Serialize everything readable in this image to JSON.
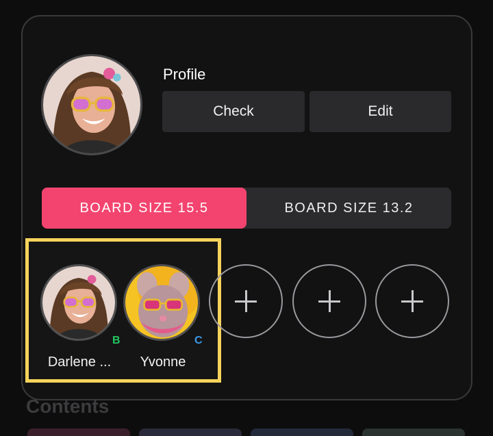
{
  "profile": {
    "label": "Profile",
    "check_label": "Check",
    "edit_label": "Edit"
  },
  "board_size": {
    "options": [
      "BOARD SIZE 15.5",
      "BOARD SIZE 13.2"
    ],
    "selected": "BOARD SIZE 15.5"
  },
  "users": [
    {
      "name": "Darlene ...",
      "badge": "B",
      "badge_color": "#22c55e"
    },
    {
      "name": "Yvonne",
      "badge": "C",
      "badge_color": "#3b9ae8"
    }
  ],
  "add_slots": 3,
  "contents_heading": "Contents",
  "colors": {
    "accent": "#f2446f",
    "highlight": "#f6d35b",
    "background": "#0d0d0e"
  }
}
